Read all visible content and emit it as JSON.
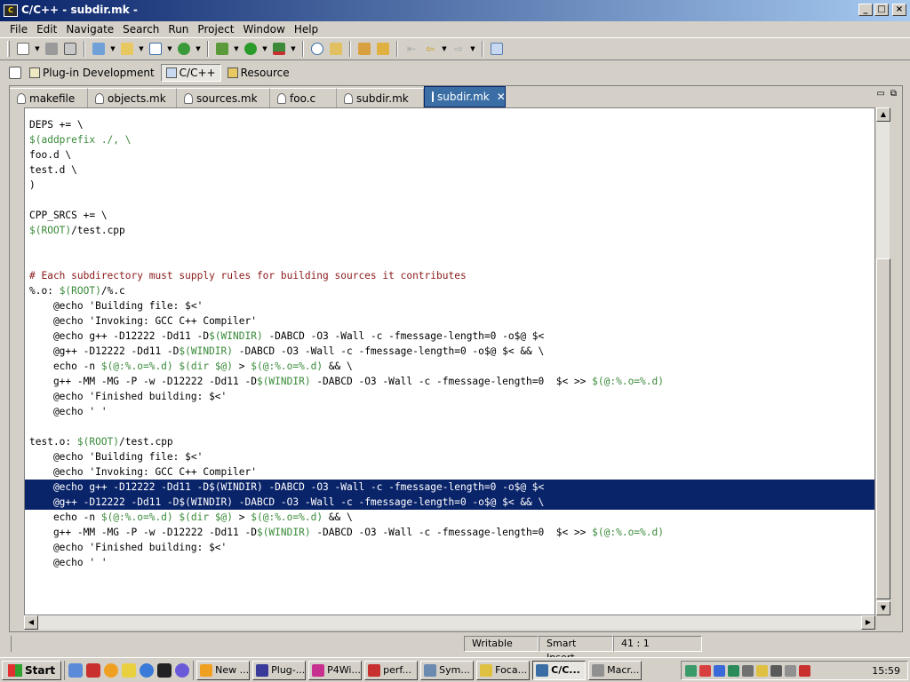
{
  "window": {
    "title": "C/C++ - subdir.mk -"
  },
  "menu": [
    "File",
    "Edit",
    "Navigate",
    "Search",
    "Run",
    "Project",
    "Window",
    "Help"
  ],
  "perspectives": [
    {
      "label": "Plug-in Development",
      "active": false
    },
    {
      "label": "C/C++",
      "active": true
    },
    {
      "label": "Resource",
      "active": false
    }
  ],
  "tabs": [
    {
      "label": "makefile",
      "active": false
    },
    {
      "label": "objects.mk",
      "active": false
    },
    {
      "label": "sources.mk",
      "active": false
    },
    {
      "label": "foo.c",
      "active": false
    },
    {
      "label": "subdir.mk",
      "active": false
    },
    {
      "label": "subdir.mk",
      "active": true
    }
  ],
  "code_lines": [
    "DEPS += \\",
    "$(addprefix ./, \\",
    "foo.d \\",
    "test.d \\",
    ")",
    "",
    "CPP_SRCS += \\",
    "$(ROOT)/test.cpp",
    "",
    "",
    "# Each subdirectory must supply rules for building sources it contributes",
    "%.o: $(ROOT)/%.c",
    "    @echo 'Building file: $<'",
    "    @echo 'Invoking: GCC C++ Compiler'",
    "    @echo g++ -D12222 -Dd11 -D$(WINDIR) -DABCD -O3 -Wall -c -fmessage-length=0 -o$@ $<",
    "    @g++ -D12222 -Dd11 -D$(WINDIR) -DABCD -O3 -Wall -c -fmessage-length=0 -o$@ $< && \\",
    "    echo -n $(@:%.o=%.d) $(dir $@) > $(@:%.o=%.d) && \\",
    "    g++ -MM -MG -P -w -D12222 -Dd11 -D$(WINDIR) -DABCD -O3 -Wall -c -fmessage-length=0  $< >> $(@:%.o=%.d)",
    "    @echo 'Finished building: $<'",
    "    @echo ' '",
    "",
    "test.o: $(ROOT)/test.cpp",
    "    @echo 'Building file: $<'",
    "    @echo 'Invoking: GCC C++ Compiler'",
    "    @echo g++ -D12222 -Dd11 -D$(WINDIR) -DABCD -O3 -Wall -c -fmessage-length=0 -o$@ $<",
    "    @g++ -D12222 -Dd11 -D$(WINDIR) -DABCD -O3 -Wall -c -fmessage-length=0 -o$@ $< && \\",
    "    echo -n $(@:%.o=%.d) $(dir $@) > $(@:%.o=%.d) && \\",
    "    g++ -MM -MG -P -w -D12222 -Dd11 -D$(WINDIR) -DABCD -O3 -Wall -c -fmessage-length=0  $< >> $(@:%.o=%.d)",
    "    @echo 'Finished building: $<'",
    "    @echo ' '"
  ],
  "selected_lines": [
    24,
    25
  ],
  "status": {
    "writable": "Writable",
    "insert_mode": "Smart Insert",
    "position": "41 : 1"
  },
  "taskbar": {
    "start_label": "Start",
    "tasks": [
      {
        "label": "New ...",
        "active": false
      },
      {
        "label": "Plug-...",
        "active": false
      },
      {
        "label": "P4Wi...",
        "active": false
      },
      {
        "label": "perf...",
        "active": false
      },
      {
        "label": "Sym...",
        "active": false
      },
      {
        "label": "Foca...",
        "active": false
      },
      {
        "label": "C/C...",
        "active": true
      },
      {
        "label": "Macr...",
        "active": false
      }
    ],
    "clock": "15:59"
  }
}
